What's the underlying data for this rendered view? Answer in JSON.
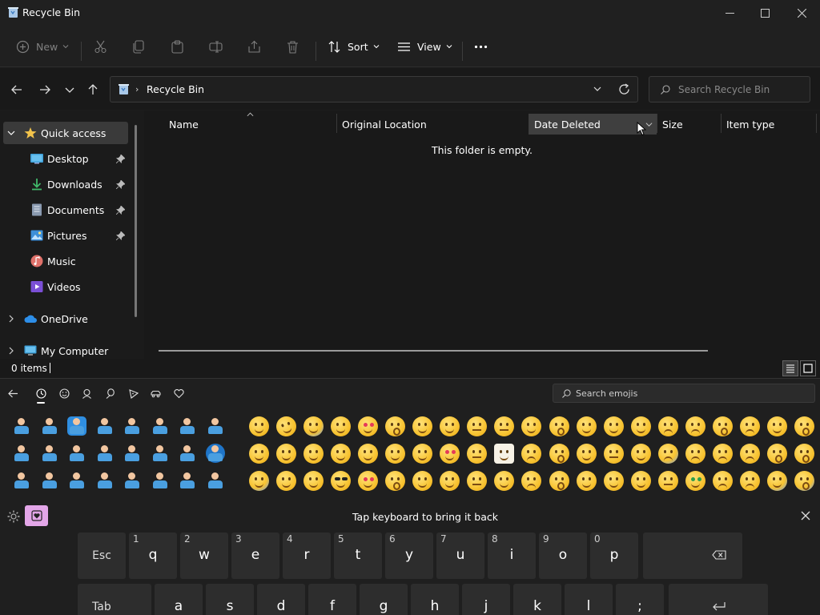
{
  "window": {
    "title": "Recycle Bin"
  },
  "toolbar": {
    "new_label": "New",
    "sort_label": "Sort",
    "view_label": "View"
  },
  "address": {
    "path": "Recycle Bin",
    "search_placeholder": "Search Recycle Bin"
  },
  "sidebar": {
    "quick_access": "Quick access",
    "items": [
      {
        "label": "Desktop",
        "icon": "desktop-icon"
      },
      {
        "label": "Downloads",
        "icon": "download-icon"
      },
      {
        "label": "Documents",
        "icon": "document-icon"
      },
      {
        "label": "Pictures",
        "icon": "pictures-icon"
      },
      {
        "label": "Music",
        "icon": "music-icon"
      },
      {
        "label": "Videos",
        "icon": "videos-icon"
      }
    ],
    "onedrive": "OneDrive",
    "computer": "My Computer"
  },
  "columns": {
    "name": "Name",
    "original_location": "Original Location",
    "date_deleted": "Date Deleted",
    "size": "Size",
    "item_type": "Item type"
  },
  "content": {
    "empty_message": "This folder is empty."
  },
  "status": {
    "item_count": "0 items"
  },
  "emoji_panel": {
    "search_placeholder": "Search emojis",
    "hint": "Tap keyboard to bring it back"
  },
  "keyboard": {
    "row1": [
      {
        "main": "Esc",
        "alt": ""
      },
      {
        "main": "q",
        "alt": "1"
      },
      {
        "main": "w",
        "alt": "2"
      },
      {
        "main": "e",
        "alt": "3"
      },
      {
        "main": "r",
        "alt": "4"
      },
      {
        "main": "t",
        "alt": "5"
      },
      {
        "main": "y",
        "alt": "6"
      },
      {
        "main": "u",
        "alt": "7"
      },
      {
        "main": "i",
        "alt": "8"
      },
      {
        "main": "o",
        "alt": "9"
      },
      {
        "main": "p",
        "alt": "0"
      }
    ],
    "row2": [
      {
        "main": "Tab",
        "alt": ""
      },
      {
        "main": "a",
        "alt": ""
      },
      {
        "main": "s",
        "alt": ""
      },
      {
        "main": "d",
        "alt": ""
      },
      {
        "main": "f",
        "alt": ""
      },
      {
        "main": "g",
        "alt": ""
      },
      {
        "main": "h",
        "alt": ""
      },
      {
        "main": "j",
        "alt": ""
      },
      {
        "main": "k",
        "alt": ""
      },
      {
        "main": "l",
        "alt": ""
      },
      {
        "main": ";",
        "alt": ""
      }
    ]
  },
  "colors": {
    "accent": "#e3a6e8",
    "selection": "#3a3a3a",
    "folder_yellow": "#f2c34b"
  }
}
